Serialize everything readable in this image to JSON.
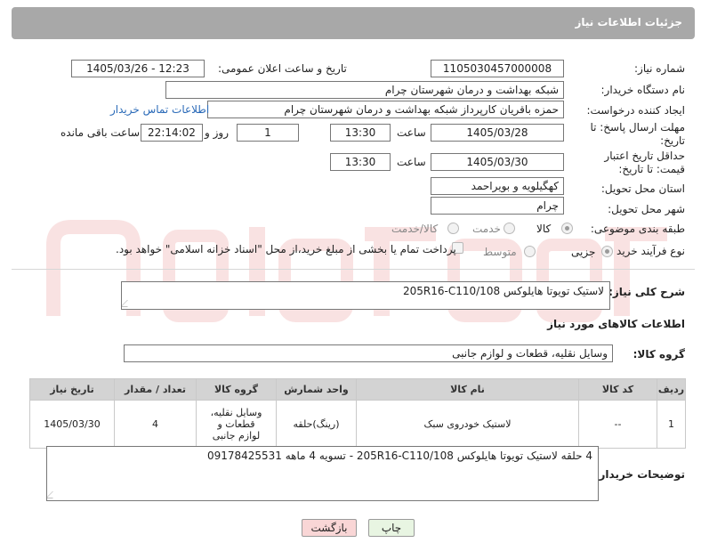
{
  "header": {
    "title": "جزئیات اطلاعات نیاز"
  },
  "fields": {
    "need_number_label": "شماره نیاز:",
    "need_number": "1105030457000008",
    "announce_label": "تاریخ و ساعت اعلان عمومی:",
    "announce_value": "1405/03/26 - 12:23",
    "buyer_label": "نام دستگاه خریدار:",
    "buyer": "شبکه بهداشت و درمان شهرستان چرام",
    "creator_label": "ایجاد کننده درخواست:",
    "creator": "حمزه باقریان کارپرداز شبکه بهداشت و درمان شهرستان چرام",
    "contact_link": "اطلاعات تماس خریدار",
    "deadline_label": "مهلت ارسال پاسخ: تا تاریخ:",
    "deadline_date": "1405/03/28",
    "time_label": "ساعت",
    "deadline_time": "13:30",
    "days_value": "1",
    "days_label": "روز و",
    "remaining_time": "22:14:02",
    "remaining_label": "ساعت باقی مانده",
    "min_price_label": "حداقل تاریخ اعتبار قیمت: تا تاریخ:",
    "min_price_date": "1405/03/30",
    "min_price_time": "13:30",
    "province_label": "استان محل تحویل:",
    "province": "کهگیلویه و بویراحمد",
    "city_label": "شهر محل تحویل:",
    "city": "چرام",
    "category_label": "طبقه بندی موضوعی:",
    "category_options": [
      "کالا",
      "خدمت",
      "کالا/خدمت"
    ],
    "purchase_label": "نوع فرآیند خرید :",
    "purchase_options": [
      "جزیی",
      "متوسط"
    ],
    "payment_note": "پرداخت تمام یا بخشی از مبلغ خرید،از محل \"اسناد خزانه اسلامی\" خواهد بود."
  },
  "description": {
    "label": "شرح کلی نیاز:",
    "value": "لاستیک تویوتا هایلوکس 205R16-C110/108"
  },
  "goods_section": {
    "title": "اطلاعات کالاهای مورد نیاز",
    "group_label": "گروه کالا:",
    "group_value": "وسایل نقلیه، قطعات و لوازم جانبی"
  },
  "table": {
    "headers": [
      "ردیف",
      "کد کالا",
      "نام کالا",
      "واحد شمارش",
      "گروه کالا",
      "تعداد / مقدار",
      "تاریخ نیاز"
    ],
    "rows": [
      [
        "1",
        "--",
        "لاستیک خودروی سبک",
        "(رینگ)حلقه",
        "وسایل نقلیه، قطعات و لوازم جانبی",
        "4",
        "1405/03/30"
      ]
    ]
  },
  "buyer_notes": {
    "label": "توضیحات خریدار:",
    "value": "4 حلقه لاستیک تویوتا هایلوکس 205R16-C110/108  -  تسویه 4 ماهه 09178425531"
  },
  "buttons": {
    "print": "چاپ",
    "back": "بازگشت"
  },
  "colors": {
    "header_bg": "#a8a8a8",
    "link": "#2a6ab8",
    "back_button": "#f9d6d6",
    "print_button": "#e8f5e2"
  }
}
